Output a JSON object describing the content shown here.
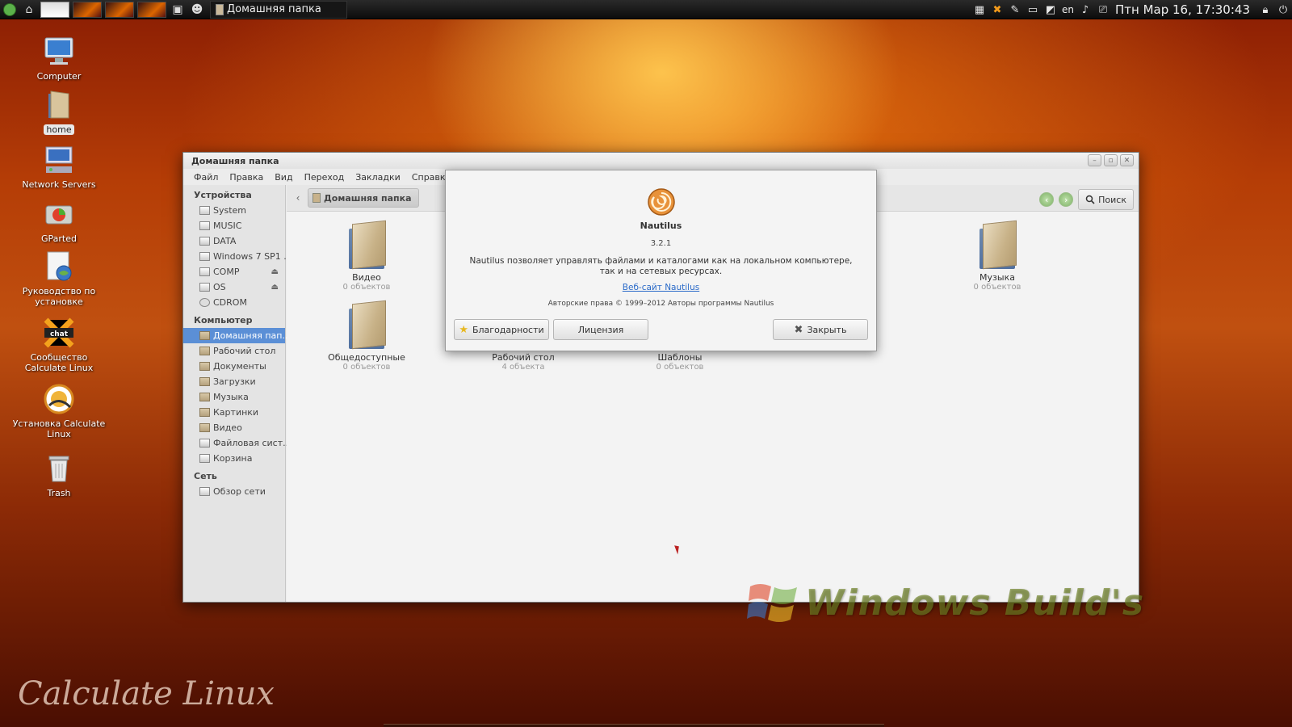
{
  "top_panel": {
    "task_title": "Домашняя папка",
    "lang": "en",
    "clock": "Птн Мар 16, 17:30:43"
  },
  "desktop": {
    "icons": [
      {
        "label": "Computer",
        "icon": "computer-icon"
      },
      {
        "label": "home",
        "icon": "home-folder-icon"
      },
      {
        "label": "Network Servers",
        "icon": "network-servers-icon"
      },
      {
        "label": "GParted",
        "icon": "gparted-icon"
      },
      {
        "label": "Руководство по установке",
        "icon": "manual-icon"
      },
      {
        "label": "Сообщество Calculate Linux",
        "icon": "community-icon"
      },
      {
        "label": "Установка Calculate Linux",
        "icon": "installer-icon"
      },
      {
        "label": "Trash",
        "icon": "trash-icon"
      }
    ],
    "watermark": "Windows Build's",
    "brand": "Calculate Linux"
  },
  "window": {
    "title": "Домашняя папка",
    "menu": [
      "Файл",
      "Правка",
      "Вид",
      "Переход",
      "Закладки",
      "Справка"
    ],
    "sidebar": {
      "devices_header": "Устройства",
      "devices": [
        "System",
        "MUSIC",
        "DATA",
        "Windows 7 SP1 ...",
        "COMP",
        "OS",
        "CDROM"
      ],
      "computer_header": "Компьютер",
      "computer": [
        "Домашняя пап...",
        "Рабочий стол",
        "Документы",
        "Загрузки",
        "Музыка",
        "Картинки",
        "Видео",
        "Файловая сист...",
        "Корзина"
      ],
      "network_header": "Сеть",
      "network": [
        "Обзор сети"
      ]
    },
    "path": "Домашняя папка",
    "search_label": "Поиск",
    "files": [
      {
        "name": "Видео",
        "count": "0 объектов"
      },
      {
        "name": "Музыка",
        "count": "0 объектов"
      },
      {
        "name": "Общедоступные",
        "count": "0 объектов"
      },
      {
        "name": "Рабочий стол",
        "count": "4 объекта"
      },
      {
        "name": "Шаблоны",
        "count": "0 объектов"
      }
    ]
  },
  "about": {
    "name": "Nautilus",
    "version": "3.2.1",
    "description": "Nautilus позволяет управлять файлами и каталогами как на локальном компьютере, так и на сетевых ресурсах.",
    "link": "Веб-сайт Nautilus",
    "copyright": "Авторские права © 1999–2012 Авторы программы Nautilus",
    "credits_label": "Благодарности",
    "license_label": "Лицензия",
    "close_label": "Закрыть"
  }
}
